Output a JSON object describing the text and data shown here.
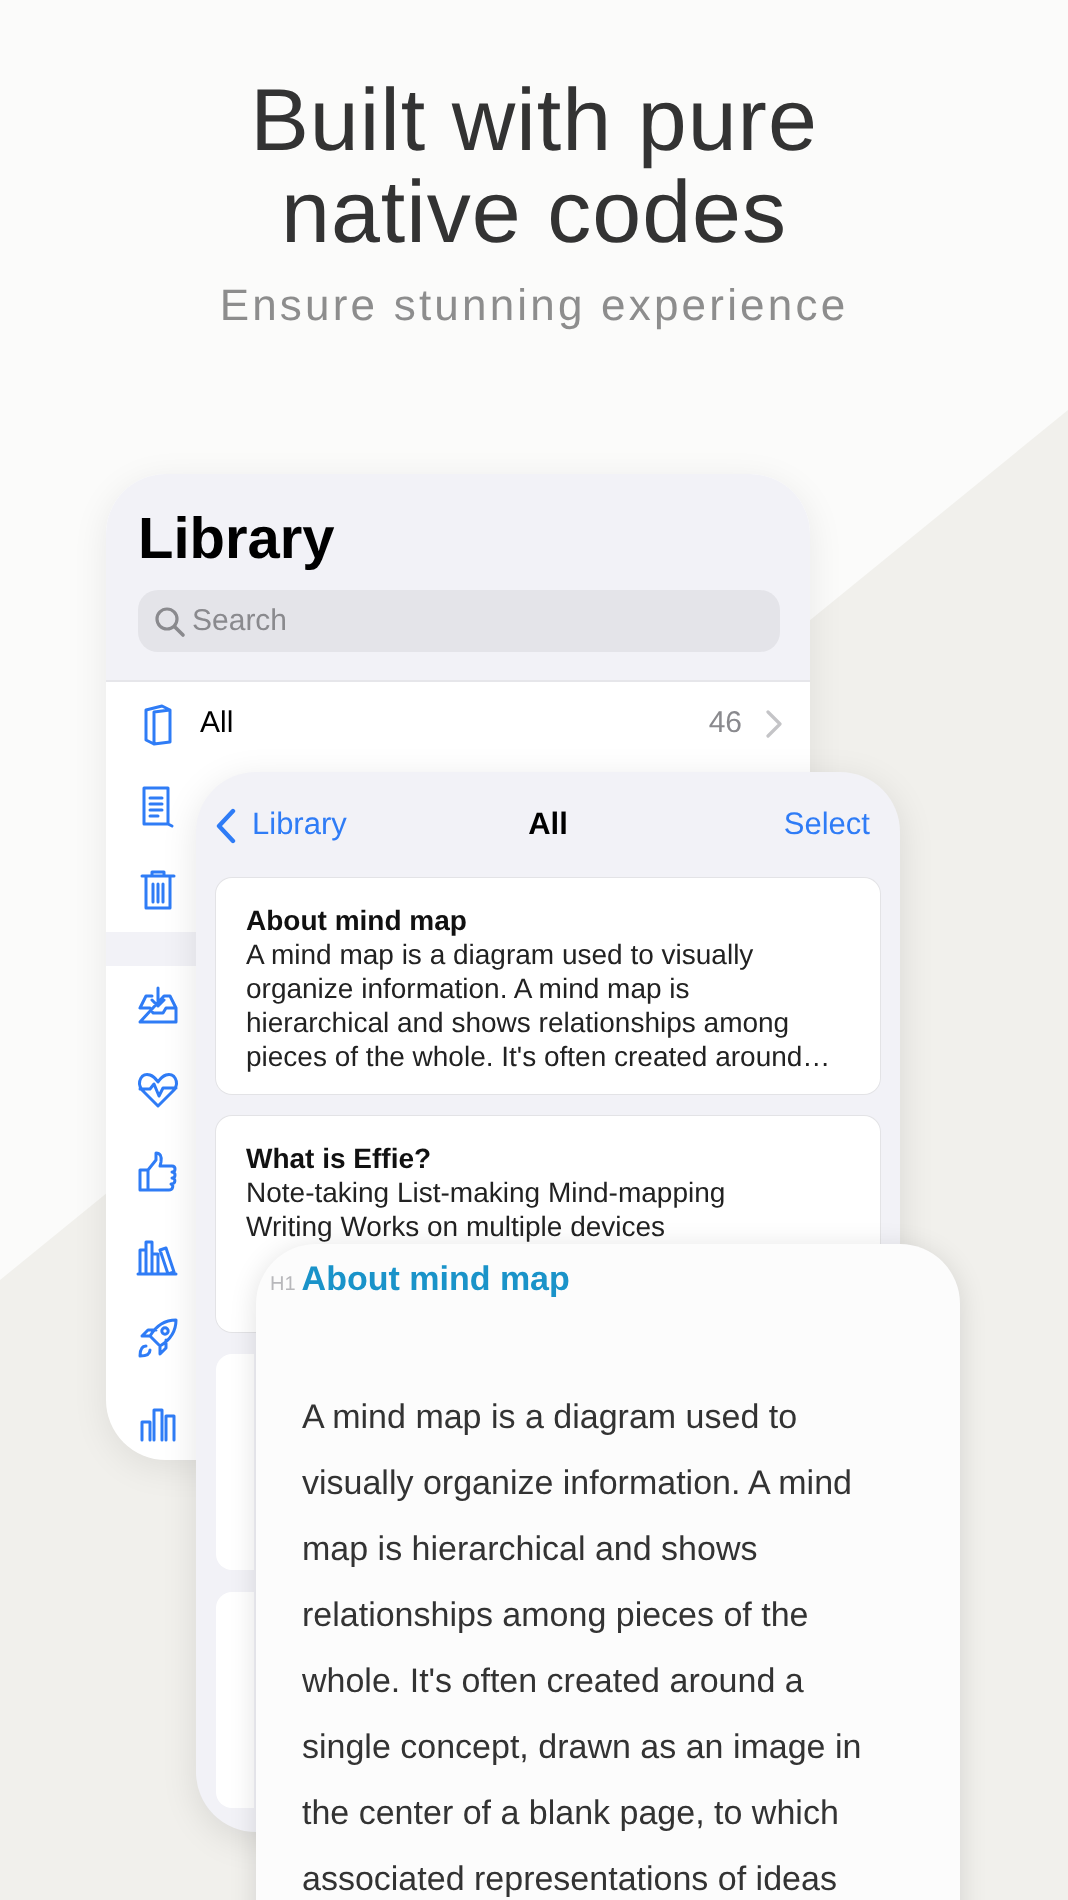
{
  "headline": {
    "title": "Built with pure native codes",
    "subtitle": "Ensure stunning experience"
  },
  "library": {
    "title": "Library",
    "search": {
      "placeholder": "Search"
    },
    "rows": [
      {
        "label": "All",
        "count": "46"
      }
    ]
  },
  "note_list": {
    "back": "Library",
    "title": "All",
    "action": "Select",
    "notes": [
      {
        "title": "About mind map",
        "lines": [
          "A mind map is a diagram used to visually",
          "organize information. A mind map is",
          "hierarchical and shows relationships among",
          "pieces of the whole. It's often created around…"
        ]
      },
      {
        "title": "What is Effie?",
        "lines": [
          "Note-taking List-making Mind-mapping",
          "Writing Works on multiple devices"
        ]
      }
    ]
  },
  "editor": {
    "heading_level": "H1",
    "title": "About mind map",
    "body_lines": [
      "A mind map is a diagram used to",
      "visually organize information. A mind",
      "map is hierarchical and shows",
      "relationships among pieces of the",
      "whole. It's often created around a",
      "single concept, drawn as an image in",
      "the center of a blank page, to which",
      "associated representations of ideas"
    ]
  }
}
